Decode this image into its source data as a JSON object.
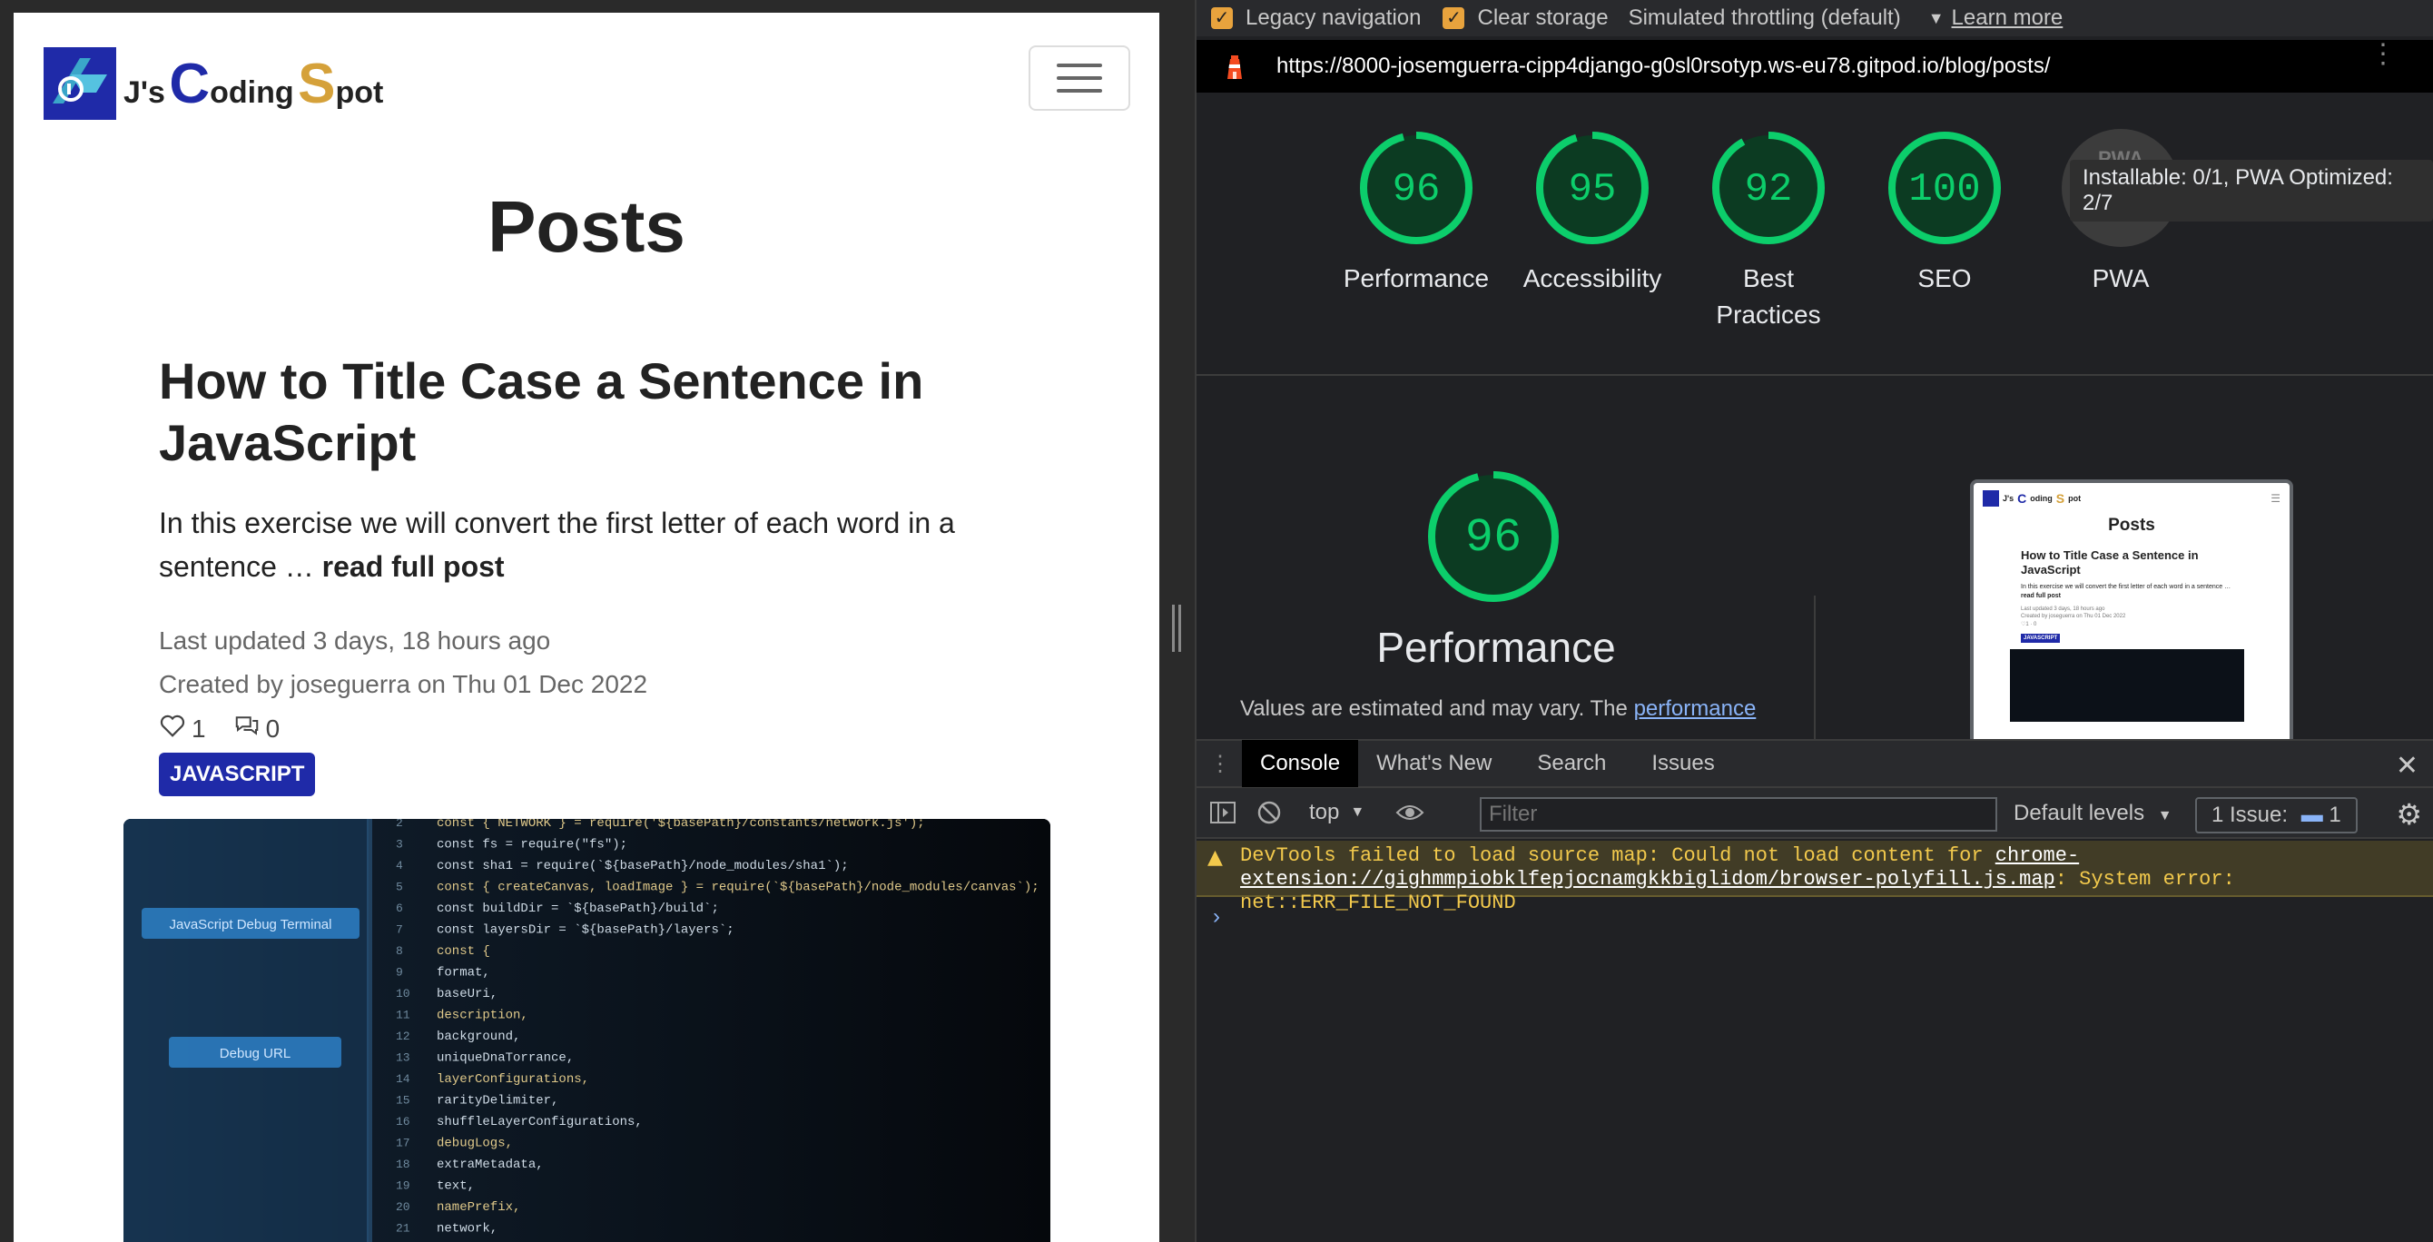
{
  "site": {
    "logo_prefix": "J's",
    "logo_c": "C",
    "logo_mid": "oding",
    "logo_s": "S",
    "logo_end": "pot",
    "page_title": "Posts",
    "post": {
      "title": "How to Title Case a Sentence in JavaScript",
      "excerpt": "In this exercise we will convert the first letter of each word in a sentence …",
      "read_more": "read full post",
      "updated": "Last updated 3 days, 18 hours ago",
      "created": "Created by joseguerra on Thu 01 Dec 2022",
      "likes": "1",
      "comments": "0",
      "tag": "JAVASCRIPT"
    },
    "code_lines": [
      "const { NETWORK } = require('${basePath}/constants/network.js');",
      "const fs = require(\"fs\");",
      "const sha1 = require(`${basePath}/node_modules/sha1`);",
      "const { createCanvas, loadImage } = require(`${basePath}/node_modules/canvas`);",
      "const buildDir = `${basePath}/build`;",
      "const layersDir = `${basePath}/layers`;",
      "const {",
      "  format,",
      "  baseUri,",
      "  description,",
      "  background,",
      "  uniqueDnaTorrance,",
      "  layerConfigurations,",
      "  rarityDelimiter,",
      "  shuffleLayerConfigurations,",
      "  debugLogs,",
      "  extraMetadata,",
      "  text,",
      "  namePrefix,",
      "  network,"
    ],
    "code_line_numbers": [
      "2",
      "3",
      "4",
      "5",
      "6",
      "7",
      "8",
      "9",
      "10",
      "11",
      "12",
      "13",
      "14",
      "15",
      "16",
      "17",
      "18",
      "19",
      "20",
      "21"
    ],
    "sidebar_items": [
      "JavaScript Debug Terminal",
      "Debug URL"
    ]
  },
  "devtools": {
    "toolbar": {
      "legacy_navigation": "Legacy navigation",
      "clear_storage": "Clear storage",
      "throttling": "Simulated throttling (default)",
      "learn_more": "Learn more"
    },
    "url": "https://8000-josemguerra-cipp4django-g0sl0rsotyp.ws-eu78.gitpod.io/blog/posts/",
    "scores": [
      {
        "value": "96",
        "label": "Performance",
        "score": 96
      },
      {
        "value": "95",
        "label": "Accessibility",
        "score": 95
      },
      {
        "value": "92",
        "label": "Best Practices",
        "score": 92
      },
      {
        "value": "100",
        "label": "SEO",
        "score": 100
      }
    ],
    "pwa": {
      "label": "PWA",
      "badge": "PWA",
      "tooltip": "Installable: 0/1, PWA Optimized: 2/7"
    },
    "performance": {
      "score": "96",
      "title": "Performance",
      "desc_prefix": "Values are estimated and may vary. The",
      "desc_link": "performance"
    },
    "thumb": {
      "title": "Posts",
      "post_title": "How to Title Case a Sentence in JavaScript",
      "excerpt": "In this exercise we will convert the first letter of each word in a sentence …",
      "read_more": "read full post",
      "updated": "Last updated 3 days, 18 hours ago",
      "created": "Created by joseguerra on Thu 01 Dec 2022",
      "counts": "♡1 · 0",
      "tag": "JAVASCRIPT"
    },
    "drawer_tabs": [
      "Console",
      "What's New",
      "Search",
      "Issues"
    ],
    "console": {
      "context": "top",
      "filter_placeholder": "Filter",
      "levels": "Default levels",
      "issues_label": "1 Issue:",
      "issues_count": "1",
      "warning_prefix": "DevTools failed to load source map: Could not load content for ",
      "warning_link": "chrome-extension://gighmmpiobklfepjocnamgkkbiglidom/browser-polyfill.js.map",
      "warning_suffix": ": System error: net::ERR_FILE_NOT_FOUND"
    }
  },
  "colors": {
    "brand_blue": "#1f2aa8",
    "brand_gold": "#d5a13a",
    "score_green": "#0cce6b",
    "warning_bg": "#413c26"
  }
}
